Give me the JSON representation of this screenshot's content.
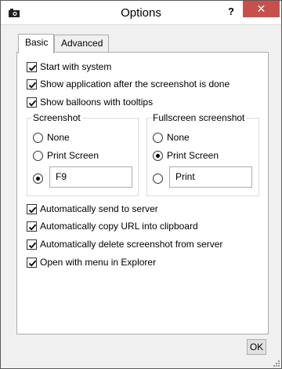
{
  "window": {
    "title": "Options",
    "help_glyph": "?",
    "close_glyph": "✕"
  },
  "tabs": [
    {
      "label": "Basic",
      "active": true
    },
    {
      "label": "Advanced",
      "active": false
    }
  ],
  "basic": {
    "options_top": [
      {
        "label": "Start with system",
        "checked": true
      },
      {
        "label": "Show application after the screenshot is done",
        "checked": true
      },
      {
        "label": "Show balloons with tooltips",
        "checked": true
      }
    ],
    "screenshot_group": {
      "title": "Screenshot",
      "radios": [
        {
          "label": "None",
          "selected": false
        },
        {
          "label": "Print Screen",
          "selected": false
        },
        {
          "label": "",
          "selected": true
        }
      ],
      "key_value": "F9"
    },
    "fullscreen_group": {
      "title": "Fullscreen screenshot",
      "radios": [
        {
          "label": "None",
          "selected": false
        },
        {
          "label": "Print Screen",
          "selected": true
        },
        {
          "label": "",
          "selected": false
        }
      ],
      "key_value": "Print"
    },
    "options_bottom": [
      {
        "label": "Automatically send to server",
        "checked": true
      },
      {
        "label": "Automatically copy URL into clipboard",
        "checked": true
      },
      {
        "label": "Automatically delete screenshot from server",
        "checked": true
      },
      {
        "label": "Open with menu in Explorer",
        "checked": true
      }
    ]
  },
  "footer": {
    "ok_label": "OK"
  }
}
